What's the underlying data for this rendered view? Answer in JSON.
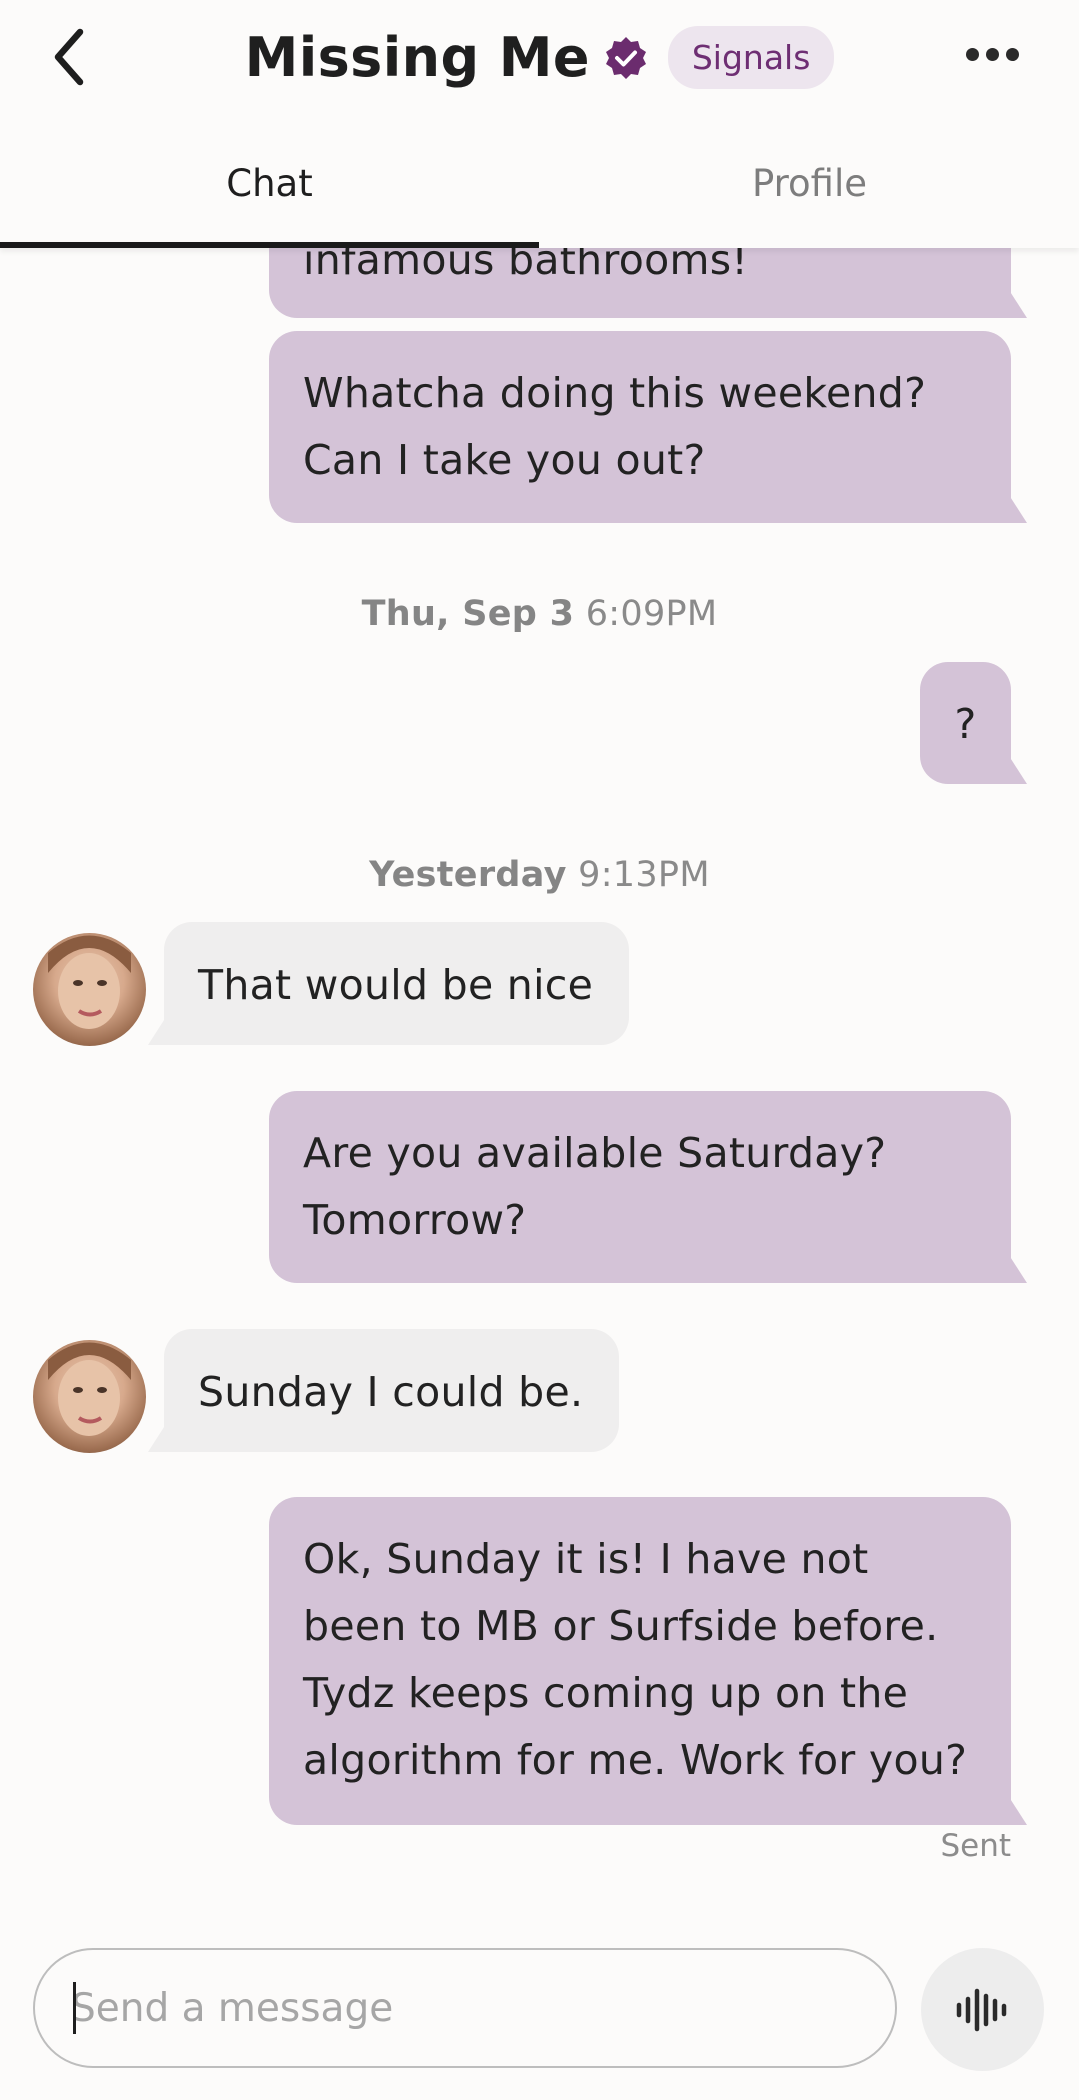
{
  "header": {
    "title": "Missing Me",
    "badge": "Signals"
  },
  "tabs": [
    {
      "label": "Chat",
      "active": true
    },
    {
      "label": "Profile",
      "active": false
    }
  ],
  "messages": [
    {
      "side": "out",
      "text": "infamous bathrooms!"
    },
    {
      "side": "out",
      "text": "Whatcha doing this weekend? Can I take you out?"
    },
    {
      "timestamp_day": "Thu, Sep 3",
      "timestamp_time": "6:09PM"
    },
    {
      "side": "out",
      "text": "?"
    },
    {
      "timestamp_day": "Yesterday",
      "timestamp_time": "9:13PM"
    },
    {
      "side": "in",
      "text": "That would be nice"
    },
    {
      "side": "out",
      "text": "Are you available Saturday? Tomorrow?"
    },
    {
      "side": "in",
      "text": "Sunday I could be."
    },
    {
      "side": "out",
      "text": "Ok, Sunday it is!  I have not been to MB or Surfside before.  Tydz keeps coming up on the algorithm for me.  Work for you?"
    }
  ],
  "status": "Sent",
  "composer": {
    "placeholder": "Send a message",
    "value": ""
  },
  "colors": {
    "outgoing_bubble": "#D4C3D7",
    "incoming_bubble": "#EFEEEE",
    "badge_bg": "#EDE5EE",
    "badge_text": "#6E2E73",
    "verified": "#6B2C6E"
  },
  "icons": [
    "chevron-left-icon",
    "verified-badge-icon",
    "more-horizontal-icon",
    "voice-waveform-icon"
  ]
}
